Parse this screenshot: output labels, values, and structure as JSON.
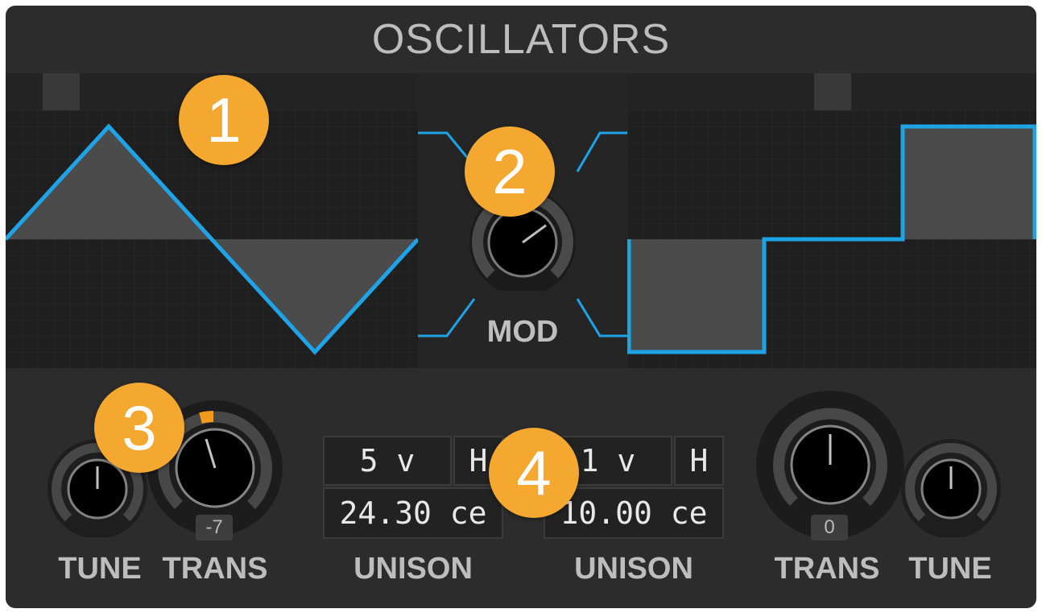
{
  "panel_title": "OSCILLATORS",
  "mod": {
    "label": "MOD"
  },
  "osc1": {
    "waveform": "triangle",
    "tune": {
      "label": "TUNE"
    },
    "trans": {
      "label": "TRANS",
      "value": "-7"
    },
    "unison": {
      "voices": "5 v",
      "mode": "H",
      "detune": "24.30 ce",
      "label": "UNISON"
    }
  },
  "osc2": {
    "waveform": "stepped",
    "tune": {
      "label": "TUNE"
    },
    "trans": {
      "label": "TRANS",
      "value": "0"
    },
    "unison": {
      "voices": "1 v",
      "mode": "H",
      "detune": "10.00 ce",
      "label": "UNISON"
    }
  },
  "callouts": [
    "1",
    "2",
    "3",
    "4"
  ],
  "colors": {
    "waveform": "#1ea3e6",
    "accent": "#f4a82f",
    "trans_indicator": "#f29a1b"
  }
}
